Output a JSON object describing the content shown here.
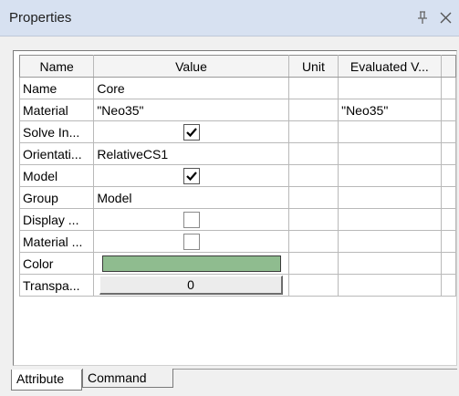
{
  "panel": {
    "title": "Properties",
    "colors": {
      "titlebar": "#d7e1f1",
      "swatch": "#8fbc8f"
    }
  },
  "table": {
    "headers": [
      "Name",
      "Value",
      "Unit",
      "Evaluated V..."
    ],
    "rows": [
      {
        "name": "Name",
        "value": "Core",
        "unit": "",
        "evaluated": ""
      },
      {
        "name": "Material",
        "value": "\"Neo35\"",
        "unit": "",
        "evaluated": "\"Neo35\""
      },
      {
        "name": "Solve In...",
        "checked": true
      },
      {
        "name": "Orientati...",
        "value": "RelativeCS1",
        "unit": "",
        "evaluated": ""
      },
      {
        "name": "Model",
        "checked": true
      },
      {
        "name": "Group",
        "value": "Model",
        "unit": "",
        "evaluated": ""
      },
      {
        "name": "Display ...",
        "checked": false
      },
      {
        "name": "Material ...",
        "checked": false
      },
      {
        "name": "Color",
        "color": "#8fbc8f"
      },
      {
        "name": "Transpa...",
        "value": "0"
      }
    ]
  },
  "tabs": [
    "Attribute",
    "Command"
  ]
}
